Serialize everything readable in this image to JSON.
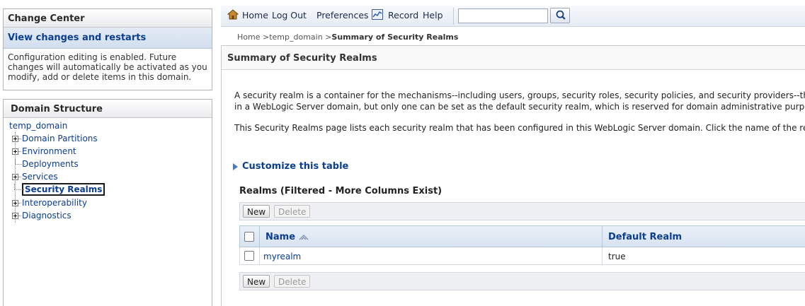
{
  "change_center": {
    "title": "Change Center",
    "view_changes_link": "View changes and restarts",
    "message_line1": "Configuration editing is enabled. Future",
    "message_line2": "changes will automatically be activated as you",
    "message_line3": "modify, add or delete items in this domain."
  },
  "domain_structure": {
    "title": "Domain Structure",
    "root": "temp_domain",
    "items": [
      {
        "label": "Domain Partitions",
        "expandable": true
      },
      {
        "label": "Environment",
        "expandable": true
      },
      {
        "label": "Deployments",
        "expandable": false
      },
      {
        "label": "Services",
        "expandable": true
      },
      {
        "label": "Security Realms",
        "expandable": false,
        "selected": true
      },
      {
        "label": "Interoperability",
        "expandable": true
      },
      {
        "label": "Diagnostics",
        "expandable": true
      }
    ]
  },
  "toolbar": {
    "home": "Home",
    "logout": "Log Out",
    "preferences": "Preferences",
    "record": "Record",
    "help": "Help",
    "search_value": ""
  },
  "breadcrumb": {
    "home": "Home >",
    "domain": "temp_domain >",
    "current": "Summary of Security Realms"
  },
  "main": {
    "title": "Summary of Security Realms",
    "para1_line1": "A security realm is a container for the mechanisms--including users, groups, security roles, security policies, and security providers--that ar",
    "para1_line2": "in a WebLogic Server domain, but only one can be set as the default security realm, which is reserved for domain administrative purposes.",
    "para2": "This Security Realms page lists each security realm that has been configured in this WebLogic Server domain. Click the name of the realm t",
    "customize_link": "Customize this table",
    "table_title": "Realms (Filtered - More Columns Exist)",
    "new_label": "New",
    "delete_label": "Delete",
    "columns": [
      "Name",
      "Default Realm"
    ],
    "rows": [
      {
        "name": "myrealm",
        "default_realm": "true"
      }
    ]
  },
  "colors": {
    "link": "#0b3d91",
    "header_bg": "#d8e3f1",
    "accent": "#4a7bc0"
  }
}
